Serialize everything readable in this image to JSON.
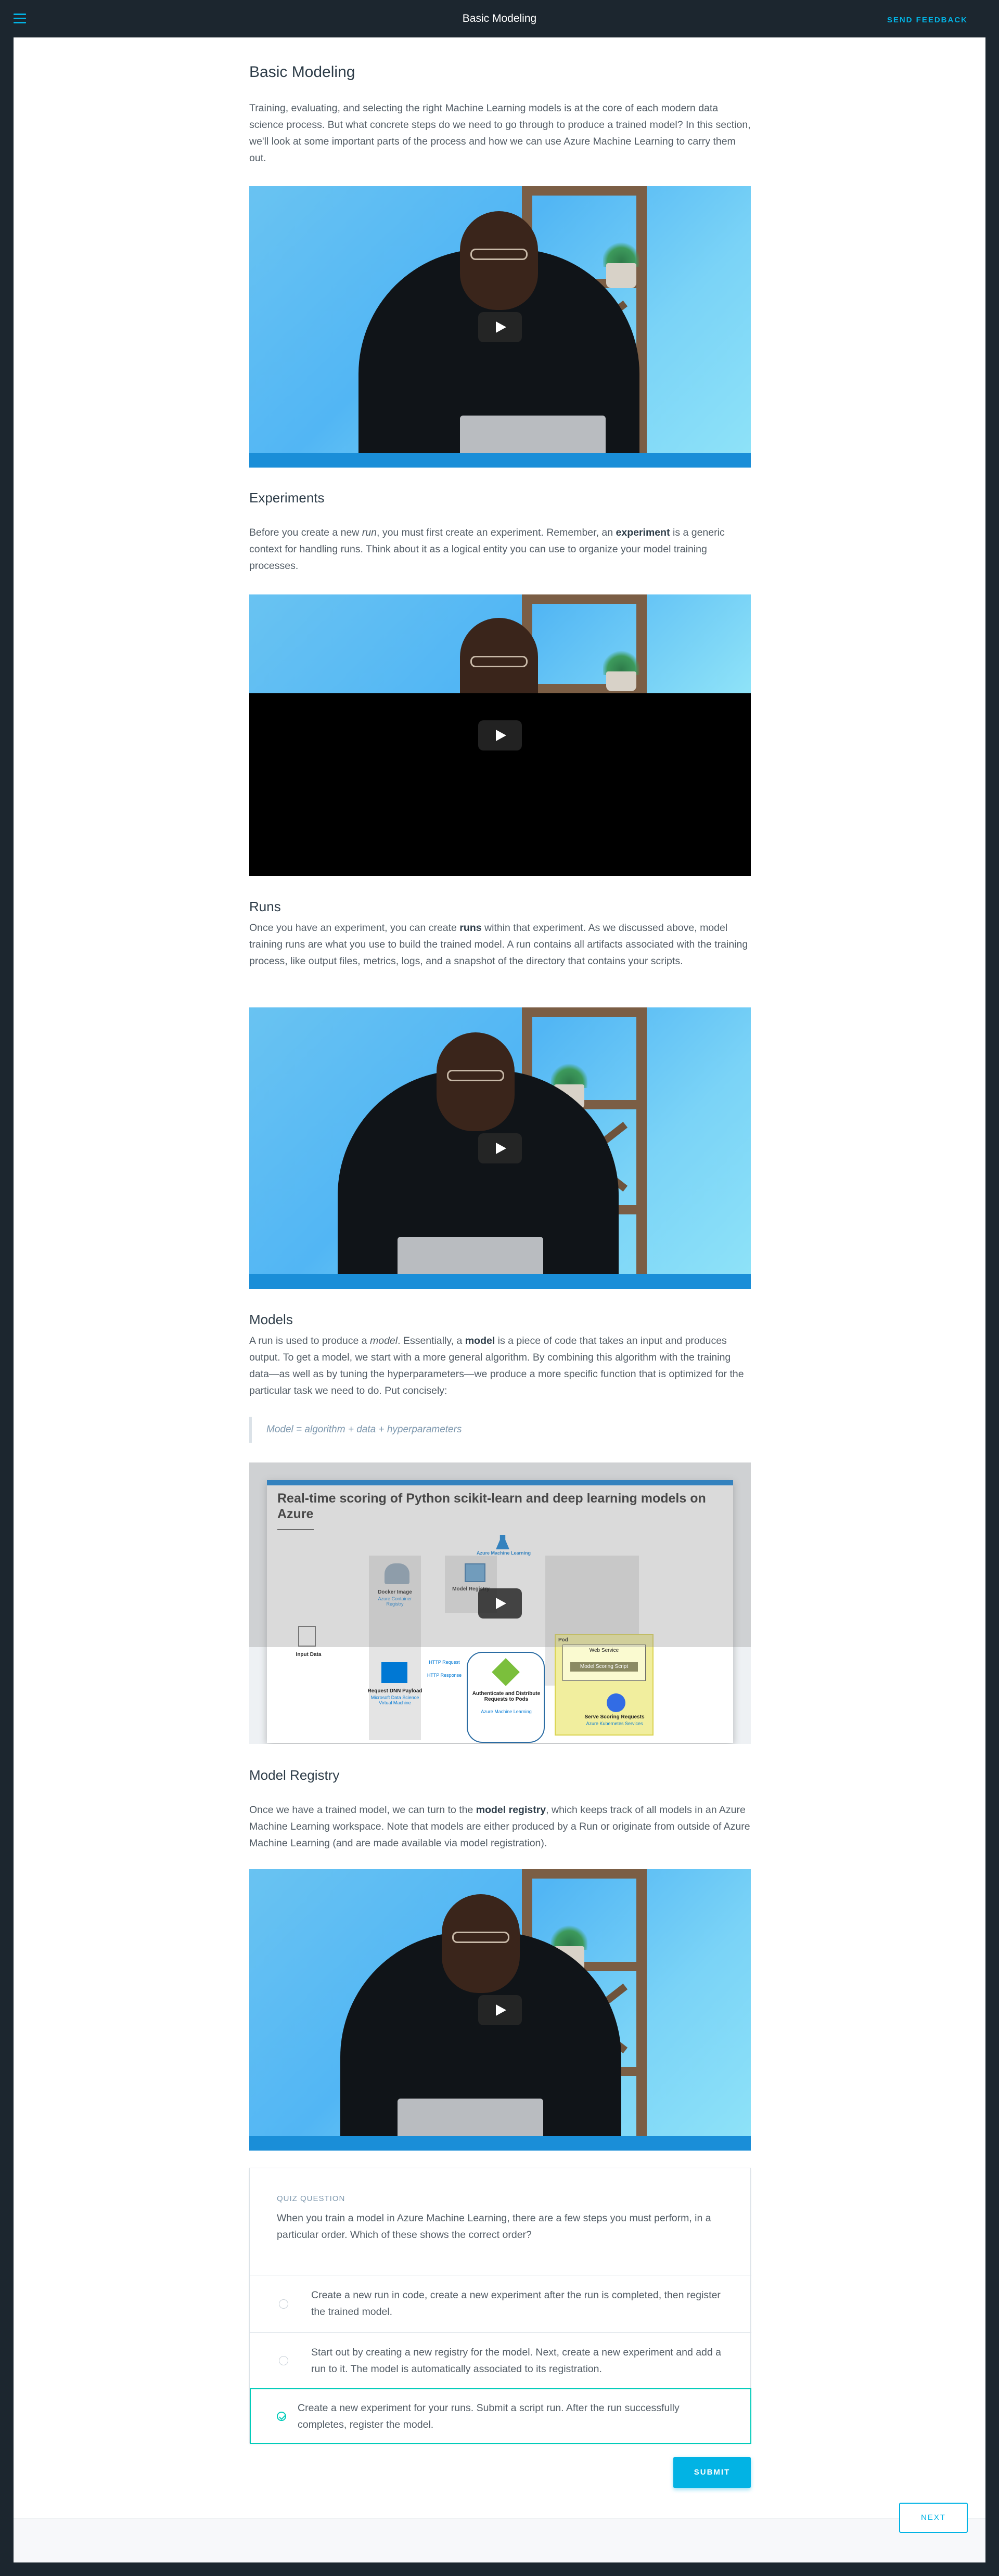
{
  "topbar": {
    "title": "Basic Modeling",
    "feedback_label": "SEND FEEDBACK",
    "menu_icon": "hamburger-menu-icon"
  },
  "sections": {
    "intro": {
      "heading": "Basic Modeling",
      "text": "Training, evaluating, and selecting the right Machine Learning models is at the core of each modern data science process. But what concrete steps do we need to go through to produce a trained model? In this section, we'll look at some important parts of the process and how we can use Azure Machine Learning to carry them out."
    },
    "experiments": {
      "heading": "Experiments",
      "text_before": "Before you create a new ",
      "text_em": "run",
      "text_mid": ", you must first create an experiment. Remember, an ",
      "text_bold": "experiment",
      "text_after": " is a generic context for handling runs. Think about it as a logical entity you can use to organize your model training processes."
    },
    "runs": {
      "heading": "Runs",
      "text_before": "Once you have an experiment, you can create ",
      "text_bold": "runs",
      "text_after": " within that experiment. As we discussed above, model training runs are what you use to build the trained model. A run contains all artifacts associated with the training process, like output files, metrics, logs, and a snapshot of the directory that contains your scripts."
    },
    "models": {
      "heading": "Models",
      "text_before": "A run is used to produce a ",
      "text_em": "model",
      "text_mid": ". Essentially, a ",
      "text_bold": "model",
      "text_after": " is a piece of code that takes an input and produces output. To get a model, we start with a more general algorithm. By combining this algorithm with the training data—as well as by tuning the hyperparameters—we produce a more specific function that is optimized for the particular task we need to do. Put concisely:",
      "quote": "Model = algorithm + data + hyperparameters"
    },
    "registry": {
      "heading": "Model Registry",
      "text_before": "Once we have a trained model, we can turn to the ",
      "text_bold": "model registry",
      "text_after": ", which keeps track of all models in an Azure Machine Learning workspace. Note that models are either produced by a Run or originate from outside of Azure Machine Learning (and are made available via model registration)."
    }
  },
  "diagram": {
    "title": "Real-time scoring of Python scikit-learn and deep learning models on Azure",
    "aml": "Azure Machine Learning",
    "docker": "Docker Image",
    "docker_sub": "Azure Container Registry",
    "registry": "Model Registry",
    "input": "Input Data",
    "request": "Request DNN Payload",
    "request_sub": "Microsoft Data Science Virtual Machine",
    "http1": "HTTP Request",
    "http2": "HTTP Response",
    "auth": "Authenticate and Distribute Requests to Pods",
    "auth_sub": "Azure Machine Learning",
    "pod": "Pod",
    "webservice": "Web Service",
    "scoring": "Model Scoring Script",
    "serve": "Serve Scoring Requests",
    "serve_sub": "Azure Kubernetes Services"
  },
  "quiz": {
    "label": "QUIZ QUESTION",
    "question": "When you train a model in Azure Machine Learning, there are a few steps you must perform, in a particular order. Which of these shows the correct order?",
    "options": [
      "Create a new run in code, create a new experiment after the run is completed, then register the trained model.",
      "Start out by creating a new registry for the model. Next, create a new experiment and add a run to it. The model is automatically associated to its registration.",
      "Create a new experiment for your runs. Submit a script run. After the run successfully completes, register the model."
    ],
    "selected_index": 2,
    "submit_label": "SUBMIT"
  },
  "footer": {
    "next_label": "NEXT"
  },
  "colors": {
    "accent": "#02b3e4",
    "correct": "#02ccba",
    "topbar": "#1c262f"
  }
}
